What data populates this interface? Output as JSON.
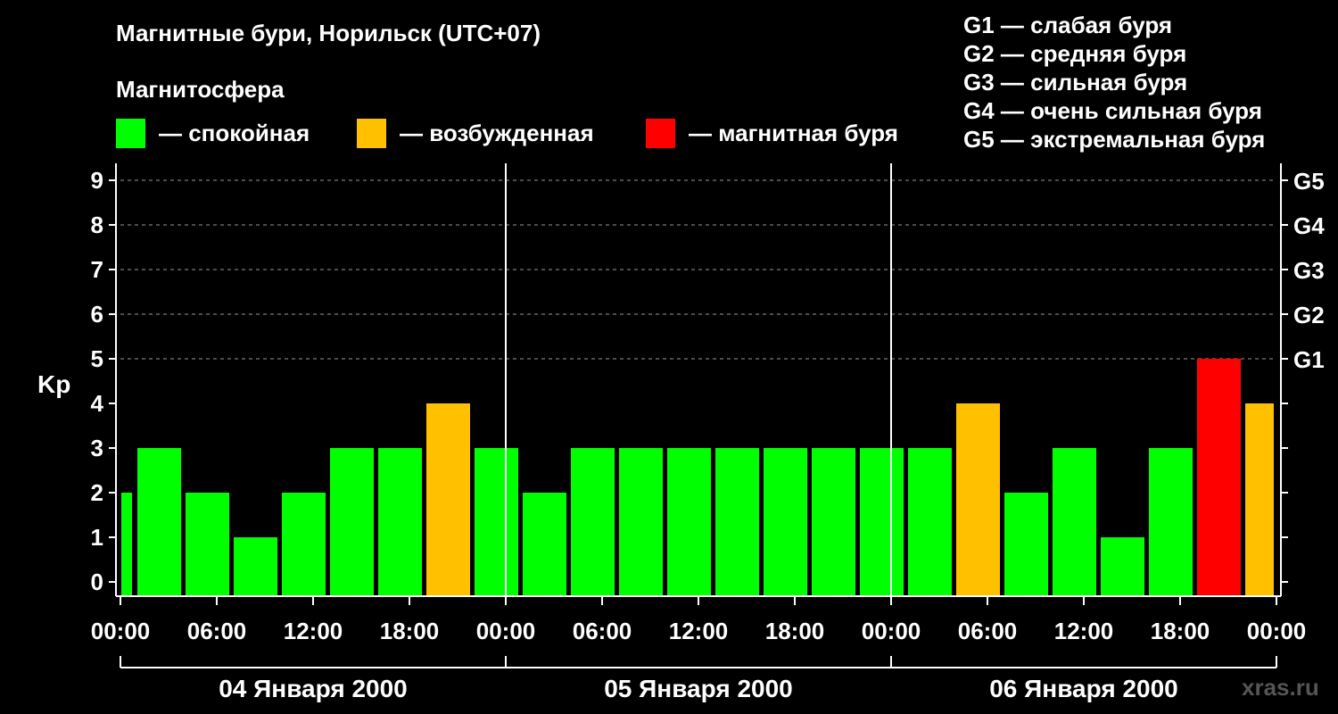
{
  "header": {
    "title": "Магнитные бури, Норильск (UTC+07)",
    "subtitle": "Магнитосфера"
  },
  "legend": [
    {
      "label": "— спокойная",
      "color": "#00ff00"
    },
    {
      "label": "— возбужденная",
      "color": "#ffc000"
    },
    {
      "label": "— магнитная буря",
      "color": "#ff0000"
    }
  ],
  "scale": [
    "G1 — слабая буря",
    "G2 — средняя буря",
    "G3 — сильная буря",
    "G4 — очень сильная буря",
    "G5 — экстремальная буря"
  ],
  "watermark": "xras.ru",
  "chart_data": {
    "type": "bar",
    "ylabel": "Kp",
    "ylim": [
      0,
      9
    ],
    "yticks": [
      "0",
      "1",
      "2",
      "3",
      "4",
      "5",
      "6",
      "7",
      "8",
      "9"
    ],
    "right_ticks": [
      {
        "value": 5,
        "label": "G1"
      },
      {
        "value": 6,
        "label": "G2"
      },
      {
        "value": 7,
        "label": "G3"
      },
      {
        "value": 8,
        "label": "G4"
      },
      {
        "value": 9,
        "label": "G5"
      }
    ],
    "xtick_labels": [
      "00:00",
      "06:00",
      "12:00",
      "18:00",
      "00:00",
      "06:00",
      "12:00",
      "18:00",
      "00:00",
      "06:00",
      "12:00",
      "18:00",
      "00:00"
    ],
    "days": [
      "04 Января 2000",
      "05 Января 2000",
      "06 Января 2000"
    ],
    "interval_hours": 3,
    "start_hour": -2,
    "values": [
      2,
      3,
      2,
      1,
      2,
      3,
      3,
      4,
      3,
      2,
      3,
      3,
      3,
      3,
      3,
      3,
      3,
      3,
      4,
      2,
      3,
      1,
      3,
      5,
      4
    ],
    "colors": {
      "quiet": "#00ff00",
      "active": "#ffc000",
      "storm": "#ff0000"
    },
    "grid": true
  }
}
